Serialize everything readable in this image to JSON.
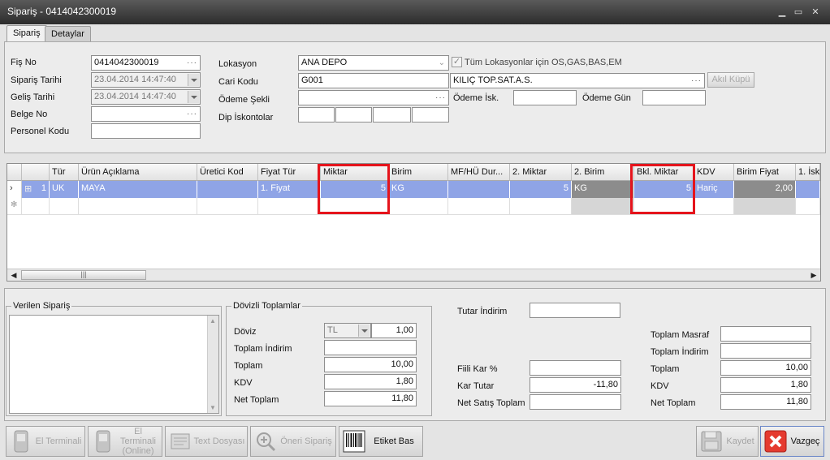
{
  "window": {
    "title": "Sipariş - 0414042300019"
  },
  "tabs": [
    {
      "label": "Sipariş"
    },
    {
      "label": "Detaylar"
    }
  ],
  "header": {
    "fis_no_label": "Fiş No",
    "fis_no": "0414042300019",
    "siparis_tarihi_label": "Sipariş Tarihi",
    "siparis_tarihi": "23.04.2014 14:47:40",
    "gelis_tarihi_label": "Geliş Tarihi",
    "gelis_tarihi": "23.04.2014 14:47:40",
    "belge_no_label": "Belge No",
    "belge_no": "",
    "personel_kodu_label": "Personel Kodu",
    "personel_kodu": "",
    "lokasyon_label": "Lokasyon",
    "lokasyon": "ANA DEPO",
    "tum_lokasyon_label": "Tüm Lokasyonlar için OS,GAS,BAS,EM",
    "cari_kodu_label": "Cari Kodu",
    "cari_kodu": "G001",
    "cari_adi": "KILIÇ TOP.SAT.A.S.",
    "akil_kupu_label": "Akıl Küpü",
    "odeme_sekli_label": "Ödeme Şekli",
    "odeme_sekli": "",
    "odeme_isk_label": "Ödeme İsk.",
    "odeme_isk": "",
    "odeme_gun_label": "Ödeme Gün",
    "odeme_gun": "",
    "dip_iskontolar_label": "Dip İskontolar"
  },
  "grid": {
    "columns": [
      "Tür",
      "Ürün Açıklama",
      "Üretici Kod",
      "Fiyat Tür",
      "Miktar",
      "Birim",
      "MF/HÜ Dur...",
      "2. Miktar",
      "2. Birim",
      "Bkl. Miktar",
      "KDV",
      "Birim Fiyat",
      "1. İsk"
    ],
    "rows": [
      {
        "row_no": "1",
        "tur": "UK",
        "urun_aciklama": "MAYA",
        "uretici_kod": "",
        "fiyat_tur": "1. Fiyat",
        "miktar": "5",
        "birim": "KG",
        "mf_hu": "",
        "miktar2": "5",
        "birim2": "KG",
        "bkl_miktar": "5",
        "kdv": "Hariç",
        "birim_fiyat": "2,00",
        "isk1": ""
      }
    ]
  },
  "verilen_siparis": {
    "label": "Verilen Sipariş"
  },
  "dovizli": {
    "label": "Dövizli Toplamlar",
    "doviz_label": "Döviz",
    "doviz_currency": "TL",
    "doviz_rate": "1,00",
    "toplam_indirim_label": "Toplam İndirim",
    "toplam_indirim": "",
    "toplam_label": "Toplam",
    "toplam": "10,00",
    "kdv_label": "KDV",
    "kdv": "1,80",
    "net_toplam_label": "Net Toplam",
    "net_toplam": "11,80"
  },
  "middle": {
    "tutar_indirim_label": "Tutar İndirim",
    "tutar_indirim": "",
    "fiili_kar_label": "Fiili Kar %",
    "fiili_kar": "",
    "kar_tutar_label": "Kar Tutar",
    "kar_tutar": "-11,80",
    "net_satis_label": "Net Satış Toplam",
    "net_satis": ""
  },
  "totals": {
    "toplam_masraf_label": "Toplam Masraf",
    "toplam_masraf": "",
    "toplam_indirim_label": "Toplam İndirim",
    "toplam_indirim": "",
    "toplam_label": "Toplam",
    "toplam": "10,00",
    "kdv_label": "KDV",
    "kdv": "1,80",
    "net_toplam_label": "Net Toplam",
    "net_toplam": "11,80"
  },
  "toolbar": {
    "el_terminali": "El Terminali",
    "el_terminali_online": "El Terminali (Online)",
    "text_dosyasi": "Text Dosyası",
    "oneri_siparis": "Öneri Sipariş",
    "etiket_bas": "Etiket Bas",
    "kaydet": "Kaydet",
    "vazgec": "Vazgeç"
  },
  "colors": {
    "selected_row": "#8fa4e6",
    "highlight": "#e5141c",
    "title_bar": "#3a3a3a"
  },
  "icons": [
    "minimize-icon",
    "maximize-icon",
    "close-icon",
    "handheld-icon",
    "text-file-icon",
    "search-add-icon",
    "barcode-icon",
    "save-disk-icon",
    "cancel-x-icon"
  ]
}
